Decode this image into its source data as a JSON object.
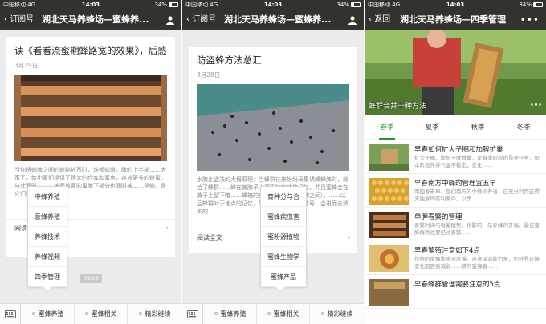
{
  "status": {
    "carrier": "中国移动",
    "network": "4G",
    "time": "14:03",
    "battery": "34%"
  },
  "phone1": {
    "back": "订阅号",
    "title": "湖北天马养蜂场—蜜蜂养...",
    "card": {
      "title": "读《看看流蜜期蜂路宽的效果》，后感",
      "date": "3月29日",
      "desc": "当你将蜂脾之间的蜂路放宽时，谁都知道，脾的上半部……大宽了，给小蜜们提供了很大的仓库和蜜房，存放更多的蜂蜜。与此同时……，被蜜放置的巢脾下部分也同时被……是蜂。是它们的摆蓝：育虫区，",
      "read_all": "阅读"
    },
    "time_pill": "09:08",
    "submenu": [
      "中蜂养殖",
      "意蜂养殖",
      "养蜂技术",
      "养蜂视频",
      "四季管理"
    ],
    "menu": [
      "蜜蜂养殖",
      "蜜蜂相关",
      "精彩继续"
    ]
  },
  "phone2": {
    "back": "订阅号",
    "title": "湖北天马养蜂场—蜜蜂养...",
    "card": {
      "title": "防盗蜂方法总汇",
      "date": "3月28日",
      "desc": "水脾止盗法的大概原理：当蜂群往来纷纷采集诱蜂蜂脾时，就给了蜂群……蜂在其脾子上留下的气味的记忆，并且蜜蜂会在脾子上留下暗……蜂箱的空脾也可杂坏于水脾之间），……以后蜂群对于地点的记忆，所以一旦蜂群……信号，会进而去消失的……",
      "read_all": "阅读全文"
    },
    "submenu": [
      "育种分与合",
      "蜜蜂病虫害",
      "蜜粉源植物",
      "蜜蜂生物学",
      "蜜蜂产品"
    ],
    "menu": [
      "蜜蜂养殖",
      "蜜蜂相关",
      "精彩继续"
    ]
  },
  "phone3": {
    "back": "返回",
    "title": "湖北天马养蜂场—四季管理",
    "more": "•••",
    "banner_caption": "蜂群合并十种方法",
    "tabs": [
      "春季",
      "夏季",
      "秋季",
      "冬季"
    ],
    "articles": [
      {
        "title": "早春如何扩大子圈和加脾扩巢",
        "desc": "扩大子圈，增加子脾数量，是春季阶段的重要任务，但本阶段外界气温不稳定，变化……"
      },
      {
        "title": "早春南方中蜂的管理宜五早",
        "desc": "南国春来早，我们南方的中蜂饲养者，应充分利用这得天独厚的有利条件，以争……"
      },
      {
        "title": "单脾春繁的管理",
        "desc": "春繁时间与春繁群势，将影响一年养蜂的开端。最佳蜜蜂群势也要经过春繁……"
      },
      {
        "title": "早春繁殖注意如下4点",
        "desc": "传统的蜜蜂繁殖速度慢，自身保温能力差，因外界环境变化而容易减弱……新的蜜蜂春……"
      },
      {
        "title": "早春蜂群管理需要注意的5点",
        "desc": ""
      }
    ]
  },
  "colors": {
    "navbar": "#32322f",
    "accent_green": "#1a9a2a",
    "background": "#ececec"
  }
}
